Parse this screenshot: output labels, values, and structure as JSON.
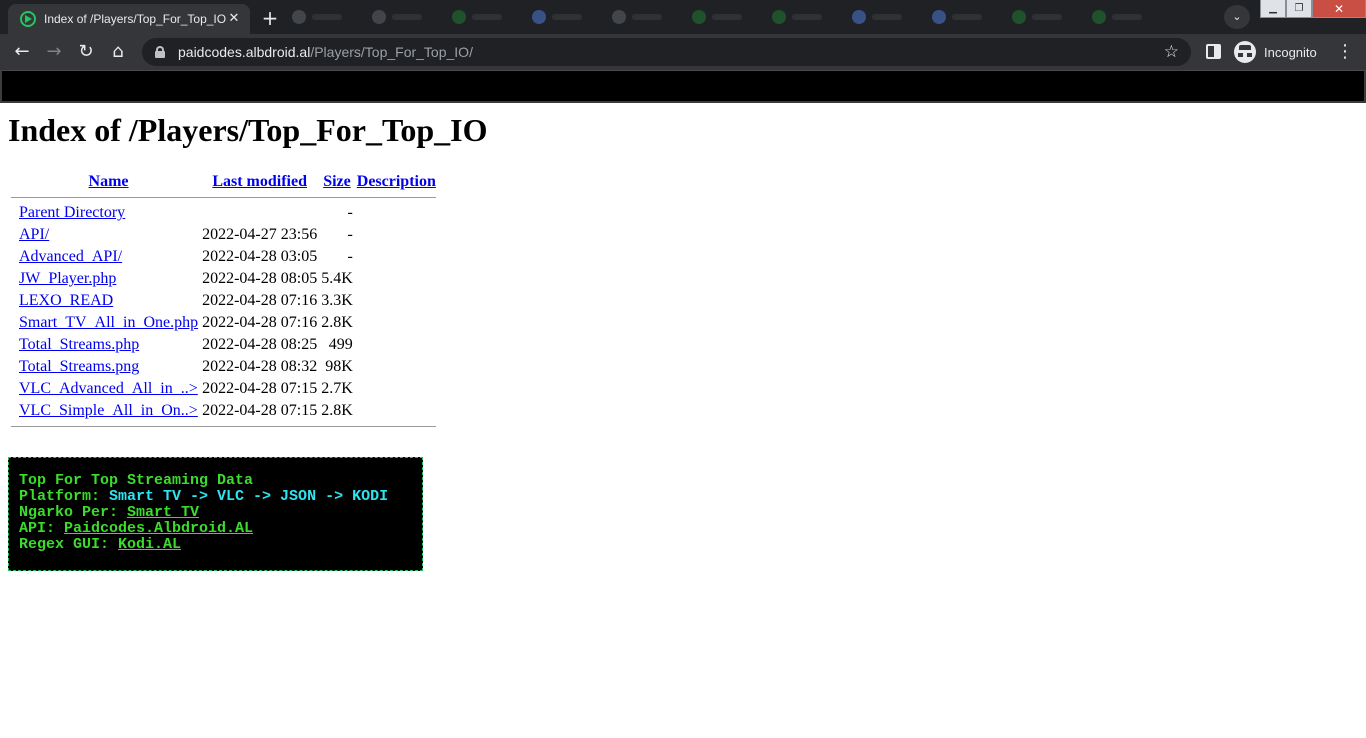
{
  "browser": {
    "tab_title": "Index of /Players/Top_For_Top_IO",
    "tab_close": "✕",
    "new_tab": "+",
    "url_host": "paidcodes.albdroid.al",
    "url_path": "/Players/Top_For_Top_IO/",
    "incognito_label": "Incognito",
    "icons": {
      "back": "←",
      "forward": "→",
      "reload": "↻",
      "home": "⌂",
      "bookmark": "☆",
      "menu": "⋮",
      "tab_search": "⌄",
      "minimize": "▁",
      "maximize": "❐",
      "close": "✕"
    }
  },
  "page": {
    "heading": "Index of /Players/Top_For_Top_IO",
    "columns": {
      "name": "Name",
      "last_modified": "Last modified",
      "size": "Size",
      "description": "Description"
    },
    "rows": [
      {
        "name": "Parent Directory",
        "modified": "",
        "size": "-"
      },
      {
        "name": "API/",
        "modified": "2022-04-27 23:56",
        "size": "-"
      },
      {
        "name": "Advanced_API/",
        "modified": "2022-04-28 03:05",
        "size": "-"
      },
      {
        "name": "JW_Player.php",
        "modified": "2022-04-28 08:05",
        "size": "5.4K"
      },
      {
        "name": "LEXO_READ",
        "modified": "2022-04-28 07:16",
        "size": "3.3K"
      },
      {
        "name": "Smart_TV_All_in_One.php",
        "modified": "2022-04-28 07:16",
        "size": "2.8K"
      },
      {
        "name": "Total_Streams.php",
        "modified": "2022-04-28 08:25",
        "size": "499"
      },
      {
        "name": "Total_Streams.png",
        "modified": "2022-04-28 08:32",
        "size": "98K"
      },
      {
        "name": "VLC_Advanced_All_in_..>",
        "modified": "2022-04-28 07:15",
        "size": "2.7K"
      },
      {
        "name": "VLC_Simple_All_in_On..>",
        "modified": "2022-04-28 07:15",
        "size": "2.8K"
      }
    ]
  },
  "info_box": {
    "title": "Top For Top Streaming Data",
    "platform_label": "Platform:",
    "platform_value": "Smart TV -> VLC -> JSON -> KODI",
    "ngarko_label": "Ngarko Per:",
    "ngarko_link": "Smart TV",
    "api_label": "API:",
    "api_link": "Paidcodes.Albdroid.AL",
    "regex_label": "Regex GUI:",
    "regex_link": "Kodi.AL"
  },
  "colors": {
    "link": "#0000ee",
    "info_green": "#3cdc2c",
    "info_cyan": "#2ee4f0",
    "chrome_dark": "#202124",
    "chrome_toolbar": "#35363a"
  }
}
